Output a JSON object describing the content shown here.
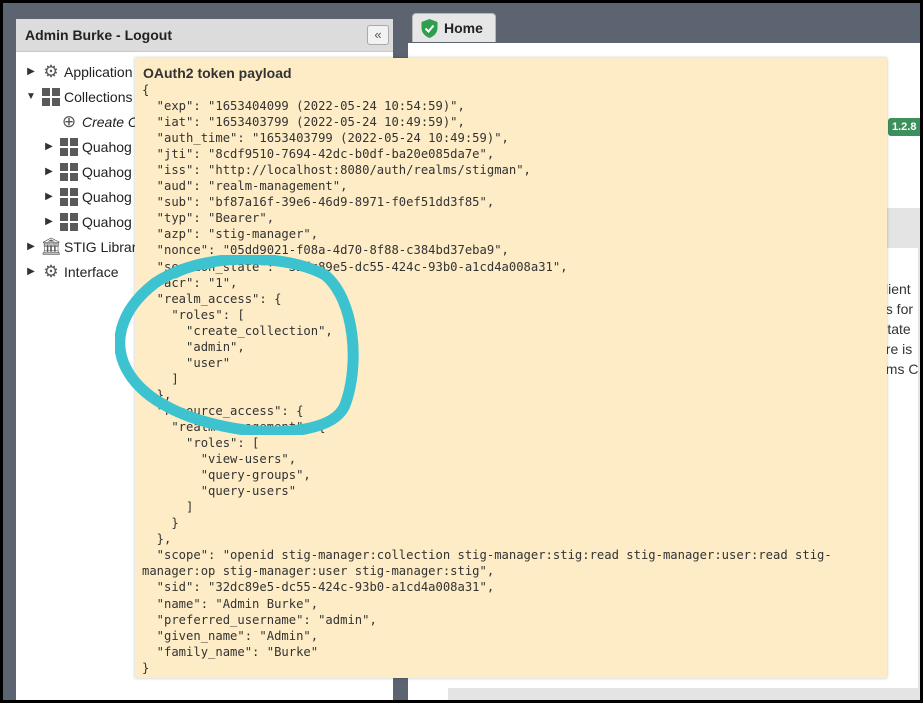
{
  "nav": {
    "title": "Admin Burke - Logout",
    "collapse": "«",
    "items": [
      {
        "label": "Application",
        "icon": "gear-icon",
        "arrow": "▶"
      },
      {
        "label": "Collections",
        "icon": "grid-icon",
        "arrow": "▼"
      },
      {
        "label": "Create C",
        "icon": "plus-circle-icon",
        "arrow": ""
      },
      {
        "label": "Quahog",
        "icon": "grid-icon",
        "arrow": "▶"
      },
      {
        "label": "Quahog",
        "icon": "grid-icon",
        "arrow": "▶"
      },
      {
        "label": "Quahog",
        "icon": "grid-icon",
        "arrow": "▶"
      },
      {
        "label": "Quahog",
        "icon": "grid-icon",
        "arrow": "▶"
      },
      {
        "label": "STIG Librar",
        "icon": "library-icon",
        "arrow": "▶"
      },
      {
        "label": "Interface",
        "icon": "gear-icon",
        "arrow": "▶"
      }
    ]
  },
  "tabs": {
    "home": "Home"
  },
  "main": {
    "version": "1.2.8",
    "fragments": [
      "client",
      "ns for",
      "State",
      "are is",
      "ems C"
    ]
  },
  "popup": {
    "title": "OAuth2 token payload",
    "payload": "{\n  \"exp\": \"1653404099 (2022-05-24 10:54:59)\",\n  \"iat\": \"1653403799 (2022-05-24 10:49:59)\",\n  \"auth_time\": \"1653403799 (2022-05-24 10:49:59)\",\n  \"jti\": \"8cdf9510-7694-42dc-b0df-ba20e085da7e\",\n  \"iss\": \"http://localhost:8080/auth/realms/stigman\",\n  \"aud\": \"realm-management\",\n  \"sub\": \"bf87a16f-39e6-46d9-8971-f0ef51dd3f85\",\n  \"typ\": \"Bearer\",\n  \"azp\": \"stig-manager\",\n  \"nonce\": \"05dd9021-f08a-4d70-8f88-c384bd37eba9\",\n  \"session_state\": \"32dc89e5-dc55-424c-93b0-a1cd4a008a31\",\n  \"acr\": \"1\",\n  \"realm_access\": {\n    \"roles\": [\n      \"create_collection\",\n      \"admin\",\n      \"user\"\n    ]\n  },\n  \"resource_access\": {\n    \"realm-management\": {\n      \"roles\": [\n        \"view-users\",\n        \"query-groups\",\n        \"query-users\"\n      ]\n    }\n  },\n  \"scope\": \"openid stig-manager:collection stig-manager:stig:read stig-manager:user:read stig-\nmanager:op stig-manager:user stig-manager:stig\",\n  \"sid\": \"32dc89e5-dc55-424c-93b0-a1cd4a008a31\",\n  \"name\": \"Admin Burke\",\n  \"preferred_username\": \"admin\",\n  \"given_name\": \"Admin\",\n  \"family_name\": \"Burke\"\n}"
  },
  "colors": {
    "highlight": "#3cc3cf",
    "popup_bg": "#fdecc6",
    "badge": "#3d8f5b"
  }
}
